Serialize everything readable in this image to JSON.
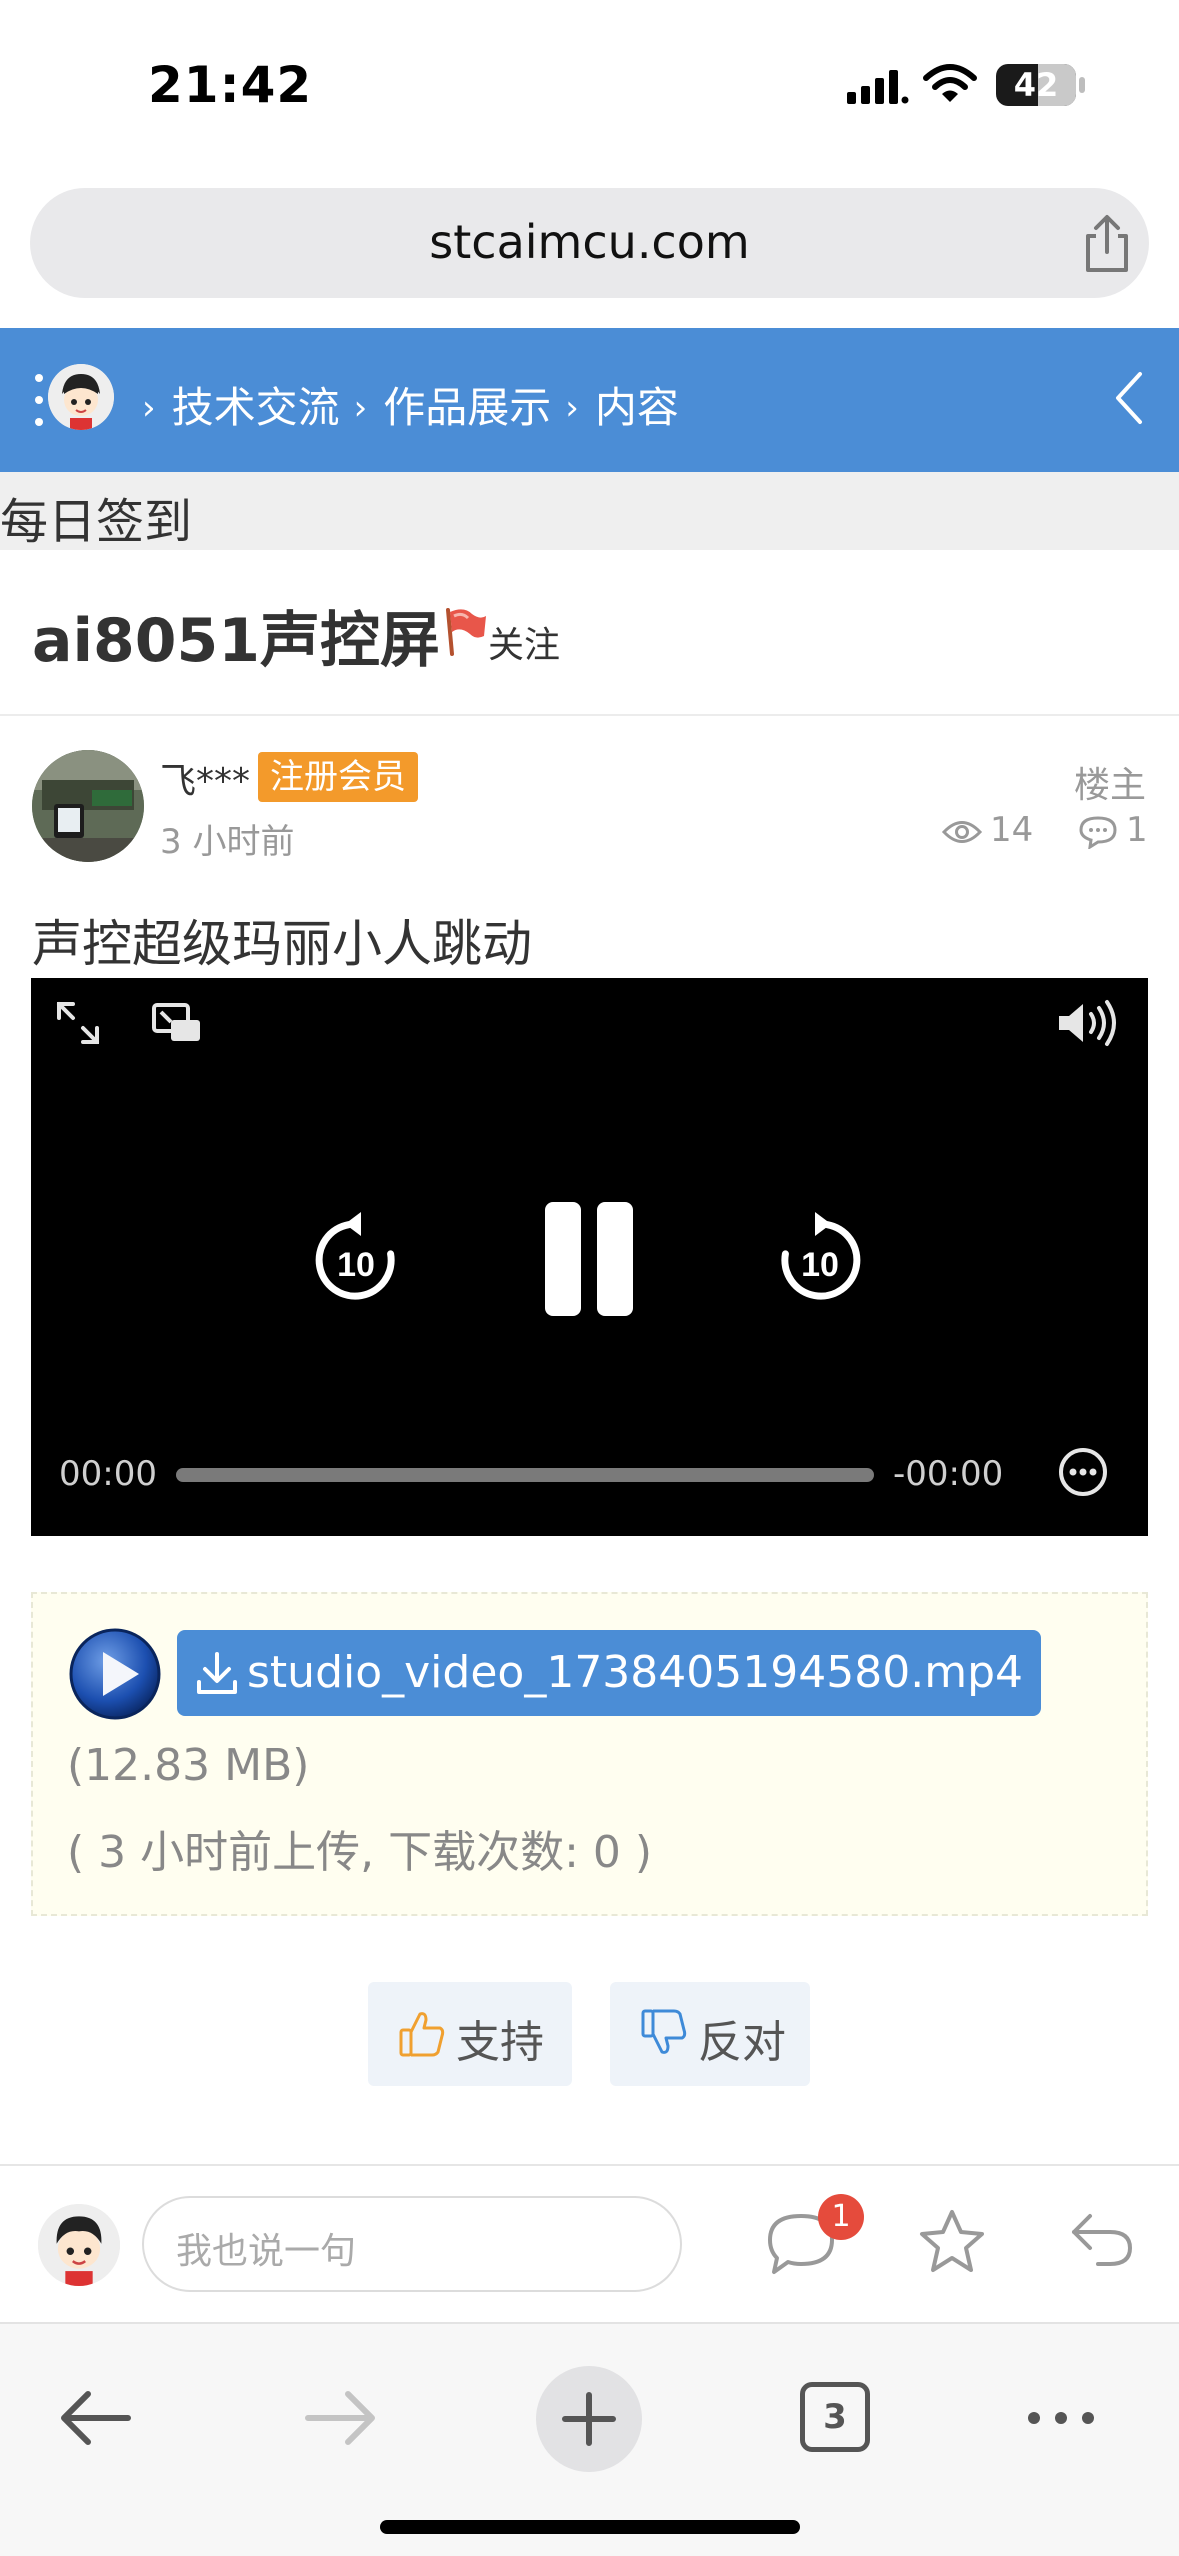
{
  "status_bar": {
    "time": "21:42",
    "battery": "42"
  },
  "browser": {
    "url": "stcaimcu.com",
    "tab_count": "3"
  },
  "breadcrumb": {
    "items": [
      "技术交流",
      "作品展示",
      "内容"
    ],
    "separator": "›"
  },
  "checkin_label": "每日签到",
  "post": {
    "title": "ai8051声控屏",
    "follow_label": "关注",
    "author": "飞***",
    "member_badge": "注册会员",
    "time": "3 小时前",
    "floor_label": "楼主",
    "views": "14",
    "comments": "1",
    "body": "声控超级玛丽小人跳动"
  },
  "video": {
    "elapsed": "00:00",
    "remaining": "-00:00",
    "skip_back": "10",
    "skip_forward": "10",
    "progress": 0
  },
  "attachment": {
    "filename": "studio_video_1738405194580.mp4",
    "size": "(12.83 MB)",
    "meta": "( 3 小时前上传, 下载次数: 0 )"
  },
  "vote": {
    "support_label": "支持",
    "oppose_label": "反对"
  },
  "reply": {
    "placeholder": "我也说一句",
    "notification_count": "1"
  },
  "colors": {
    "nav_blue": "#4b8dd6",
    "badge_orange": "#f39a2b",
    "notification_red": "#e54b3c"
  }
}
